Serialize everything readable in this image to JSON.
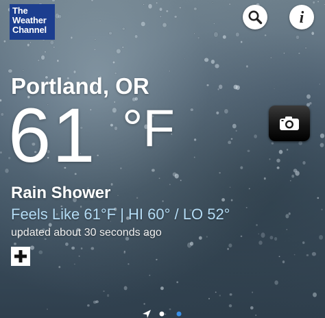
{
  "logo": {
    "line1": "The",
    "line2": "Weather",
    "line3": "Channel",
    "color": "#1c3e8f"
  },
  "header": {
    "search_icon": "search-icon",
    "info_icon": "info-icon",
    "info_glyph": "i"
  },
  "location": {
    "city": "Portland, OR"
  },
  "current": {
    "temperature": "61",
    "unit": "°F",
    "condition": "Rain Shower",
    "feels_line": "Feels Like 61°F | HI 60° / LO 52°",
    "updated": "updated about 30 seconds ago"
  },
  "actions": {
    "camera_icon": "camera-icon",
    "add_icon": "plus-icon"
  },
  "pager": {
    "items": [
      "location-arrow-icon",
      "page-dot",
      "page-dot"
    ],
    "active_index": 2,
    "active_color": "#3a8ee6"
  },
  "colors": {
    "feels_text": "#b4dcf5"
  }
}
